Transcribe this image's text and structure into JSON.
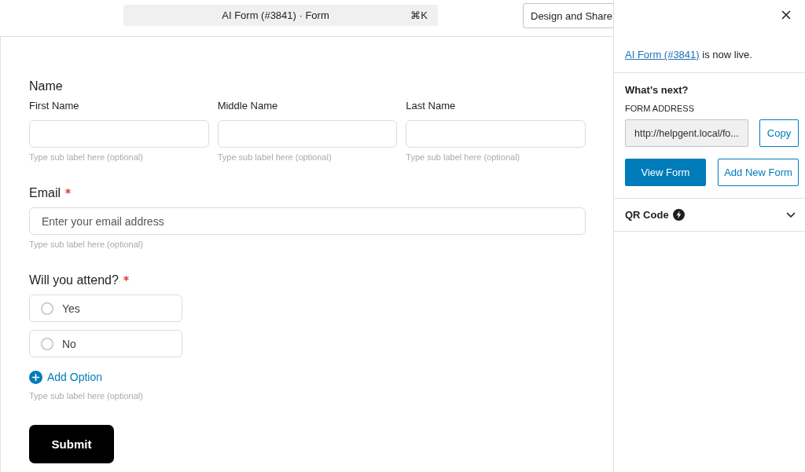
{
  "top_bar": {
    "command_bar": {
      "title": "AI Form (#3841) · Form",
      "shortcut": "⌘K"
    },
    "design_button": "Design and Share"
  },
  "form": {
    "fields": [
      {
        "kind": "name",
        "label": "Name",
        "required": false,
        "subfields": [
          {
            "label": "First Name",
            "sub_label": "Type sub label here (optional)"
          },
          {
            "label": "Middle Name",
            "sub_label": "Type sub label here (optional)"
          },
          {
            "label": "Last Name",
            "sub_label": "Type sub label here (optional)"
          }
        ]
      },
      {
        "kind": "email",
        "label": "Email",
        "required": true,
        "placeholder": "Enter your email address",
        "sub_label": "Type sub label here (optional)"
      },
      {
        "kind": "radio",
        "label": "Will you attend?",
        "required": true,
        "options": [
          {
            "label": "Yes",
            "selected": false
          },
          {
            "label": "No",
            "selected": false
          }
        ],
        "add_option": "Add Option",
        "sub_label": "Type sub label here (optional)"
      }
    ],
    "submit": "Submit"
  },
  "sidebar": {
    "notice": {
      "link": "AI Form (#3841)",
      "text": "is now live."
    },
    "next_steps": {
      "heading": "What’s next?",
      "address_label": "FORM ADDRESS",
      "address": "http://helpgent.local/fo...",
      "copy_button": "Copy",
      "view_button": "View Form",
      "add_button": "Add New Form"
    },
    "qr_code": {
      "label": "QR Code",
      "expanded": false
    }
  }
}
